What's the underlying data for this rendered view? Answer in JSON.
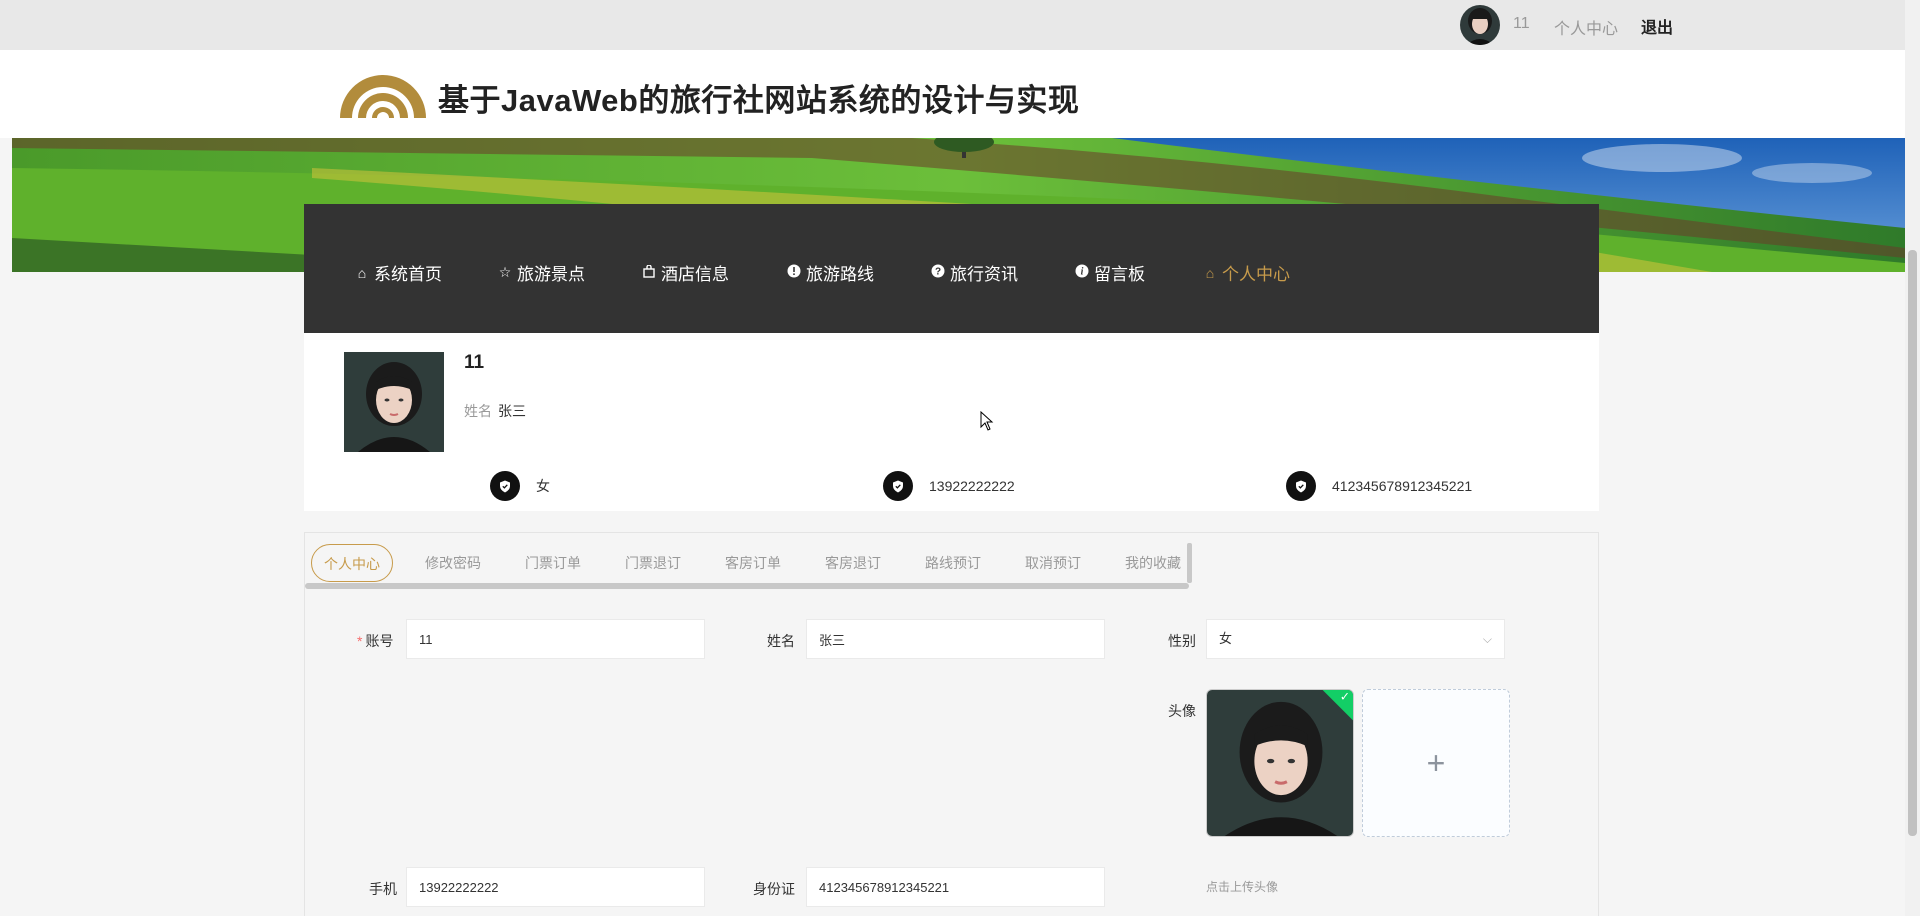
{
  "topbar": {
    "username": "11",
    "user_center": "个人中心",
    "logout": "退出"
  },
  "header": {
    "title": "基于JavaWeb的旅行社网站系统的设计与实现"
  },
  "nav": {
    "items": [
      {
        "label": "系统首页",
        "icon": "home-icon"
      },
      {
        "label": "旅游景点",
        "icon": "star-icon"
      },
      {
        "label": "酒店信息",
        "icon": "bag-icon"
      },
      {
        "label": "旅游路线",
        "icon": "info-icon"
      },
      {
        "label": "旅行资讯",
        "icon": "question-icon"
      },
      {
        "label": "留言板",
        "icon": "info-icon"
      },
      {
        "label": "个人中心",
        "icon": "home-icon"
      }
    ],
    "active_index": 6
  },
  "profile": {
    "name": "11",
    "real_name_label": "姓名",
    "real_name": "张三",
    "gender": "女",
    "phone": "13922222222",
    "id_card": "412345678912345221"
  },
  "tabs": [
    "个人中心",
    "修改密码",
    "门票订单",
    "门票退订",
    "客房订单",
    "客房退订",
    "路线预订",
    "取消预订",
    "我的收藏"
  ],
  "form": {
    "account_label": "账号",
    "account_value": "11",
    "name_label": "姓名",
    "name_value": "张三",
    "gender_label": "性别",
    "gender_value": "女",
    "avatar_label": "头像",
    "upload_plus": "+",
    "upload_tip": "点击上传头像",
    "phone_label": "手机",
    "phone_value": "13922222222",
    "idcard_label": "身份证",
    "idcard_value": "412345678912345221"
  },
  "colors": {
    "accent": "#c79b4b",
    "nav_bg": "#333333"
  }
}
